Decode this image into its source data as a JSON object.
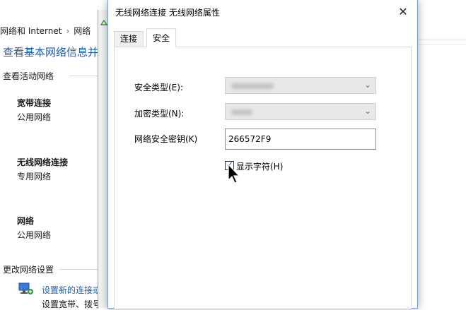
{
  "background": {
    "breadcrumb": [
      "网络和 Internet",
      "网络"
    ],
    "page_title": "查看基本网络信息并",
    "active_networks_label": "查看活动网络",
    "networks": [
      {
        "name": "宽带连接",
        "type": "公用网络"
      },
      {
        "name": "无线网络连接",
        "type": "专用网络"
      },
      {
        "name": "网络",
        "type": "公用网络"
      }
    ],
    "change_settings_label": "更改网络设置",
    "new_connection_link": "设置新的连接或",
    "new_connection_desc": "设置宽带、拨号"
  },
  "dialog": {
    "title": "无线网络连接 无线网络属性",
    "close_glyph": "✕",
    "tabs": [
      {
        "label": "连接",
        "active": false
      },
      {
        "label": "安全",
        "active": true
      }
    ],
    "security_type_label": "安全类型(E):",
    "encryption_type_label": "加密类型(N):",
    "network_key_label": "网络安全密钥(K)",
    "network_key_value": "266572F9",
    "show_chars_label": "显示字符(H)",
    "show_chars_checked": true
  },
  "colors": {
    "link": "#1a5fb4",
    "dialog_border": "#6f9bd1"
  }
}
